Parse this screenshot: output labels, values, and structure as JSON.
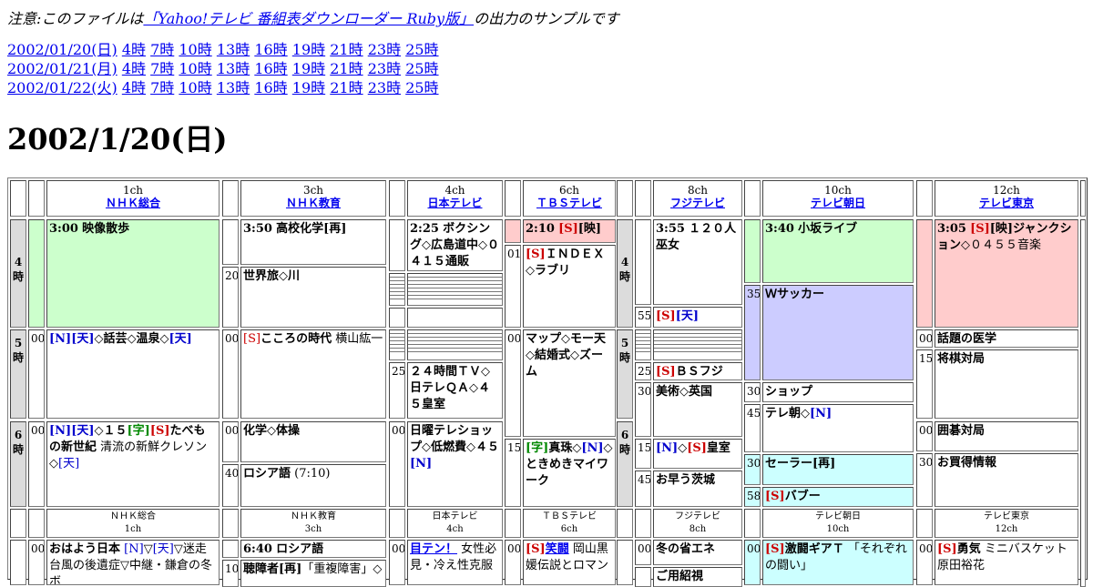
{
  "notice": {
    "prefix": "注意:このファイルは",
    "link": "「Yahoo!テレビ 番組表ダウンローダー Ruby版」",
    "suffix": "の出力のサンプルです"
  },
  "dates": [
    {
      "date": "2002/01/20(日)",
      "hours": [
        "4時",
        "7時",
        "10時",
        "13時",
        "16時",
        "19時",
        "21時",
        "23時",
        "25時"
      ]
    },
    {
      "date": "2002/01/21(月)",
      "hours": [
        "4時",
        "7時",
        "10時",
        "13時",
        "16時",
        "19時",
        "21時",
        "23時",
        "25時"
      ]
    },
    {
      "date": "2002/01/22(火)",
      "hours": [
        "4時",
        "7時",
        "10時",
        "13時",
        "16時",
        "19時",
        "21時",
        "23時",
        "25時"
      ]
    }
  ],
  "page_title": "2002/1/20(日)",
  "channels": [
    {
      "num": "1ch",
      "name": "ＮＨＫ総合"
    },
    {
      "num": "3ch",
      "name": "ＮＨＫ教育"
    },
    {
      "num": "4ch",
      "name": "日本テレビ"
    },
    {
      "num": "6ch",
      "name": "ＴＢＳテレビ"
    },
    {
      "num": "8ch",
      "name": "フジテレビ"
    },
    {
      "num": "10ch",
      "name": "テレビ朝日"
    },
    {
      "num": "12ch",
      "name": "テレビ東京"
    }
  ],
  "hour_labels": {
    "h4": "4時",
    "h5": "5時",
    "h6": "6時"
  },
  "minutes": {
    "m00": "00",
    "m01": "01",
    "m10": "10",
    "m15": "15",
    "m20": "20",
    "m25": "25",
    "m30": "30",
    "m35": "35",
    "m40": "40",
    "m45": "45",
    "m55": "55",
    "m58": "58"
  },
  "tags": {
    "S": "[S]",
    "N": "[N]",
    "ten": "[天]",
    "ji": "[字]",
    "ei": "[映]"
  },
  "programs": {
    "nhk1_a": {
      "time": "3:00",
      "title": "映像散歩"
    },
    "nhk1_b": {
      "tail": "◇話芸◇温泉◇"
    },
    "nhk1_c": {
      "t1": "◇１５",
      "t2": "たべもの新世紀",
      "sub1": " 清流の新鮮クレソン◇"
    },
    "nhk1_d": {
      "title": "おはよう日本",
      "sub": "▽迷走台風の後遺症▽中継・鎌倉の冬ボ"
    },
    "nhk3_a": {
      "time": "3:50",
      "title": "高校化学[再]"
    },
    "nhk3_b": {
      "title": "世界旅◇川"
    },
    "nhk3_c": {
      "title": "こころの時代",
      "sub": " 横山紘一"
    },
    "nhk3_d": {
      "title": "化学◇体操"
    },
    "nhk3_e": {
      "title": "ロシア語",
      "sub": " (7:10)"
    },
    "nhk3_f": {
      "time": "6:40",
      "title": "ロシア語"
    },
    "nhk3_g": {
      "title": "聴障者[再]",
      "sub": "「重複障害」◇"
    },
    "ntv_a": {
      "time": "2:25",
      "title": "ボクシング◇広島道中◇０４１５通販"
    },
    "ntv_b": {
      "title": "２４時間ＴＶ◇日テレＱＡ◇４５皇室"
    },
    "ntv_c": {
      "title": "日曜テレショップ◇低燃費◇４５"
    },
    "ntv_d": {
      "title": "目テン！",
      "sub": " 女性必見・冷え性克服"
    },
    "tbs_a": {
      "time": "2:10"
    },
    "tbs_b": {
      "title": "ＩＮＤＥＸ◇ラブリ"
    },
    "tbs_c": {
      "title": "マップ◇モー天◇結婚式◇ズーム"
    },
    "tbs_d": {
      "t1": "真珠◇",
      "t2": "◇ときめきマイワーク"
    },
    "tbs_e": {
      "title": "笑闘",
      "sub": " 岡山黒媛伝説とロマン"
    },
    "cx_a": {
      "time": "3:55",
      "title": "１２０人巫女"
    },
    "cx_c": {
      "title": "ＢＳフジ"
    },
    "cx_d": {
      "title": "美術◇英国"
    },
    "cx_e": {
      "t1": "◇",
      "t2": "皇室"
    },
    "cx_f": {
      "title": "お早う茨城"
    },
    "cx_g": {
      "title": "冬の省エネ"
    },
    "cx_h": {
      "title": "ご用紹視"
    },
    "ex_a": {
      "time": "3:40",
      "title": "小坂ライブ"
    },
    "ex_b": {
      "title": "Ｗサッカー"
    },
    "ex_c": {
      "title": "ショップ"
    },
    "ex_d": {
      "title": "テレ朝◇"
    },
    "ex_e": {
      "title": "セーラー[再]"
    },
    "ex_f": {
      "title": "バブー"
    },
    "ex_g": {
      "title": "激闘ギアＴ",
      "sub": "「それぞれの闘い」"
    },
    "tx_a": {
      "time": "3:05",
      "t1": "ジャンクション",
      "sub": "◇０４５５音楽"
    },
    "tx_b": {
      "title": "話題の医学"
    },
    "tx_c": {
      "title": "将棋対局"
    },
    "tx_d": {
      "title": "囲碁対局"
    },
    "tx_e": {
      "title": "お買得情報"
    },
    "tx_f": {
      "title": "勇気",
      "sub": " ミニバスケット原田裕花"
    }
  },
  "colors": {
    "green": "#ccffcc",
    "pink": "#ffcccc",
    "purple": "#ccccff",
    "cyan": "#ccffff",
    "hour_bg": "#dcdcdc",
    "link": "#0000ee"
  }
}
